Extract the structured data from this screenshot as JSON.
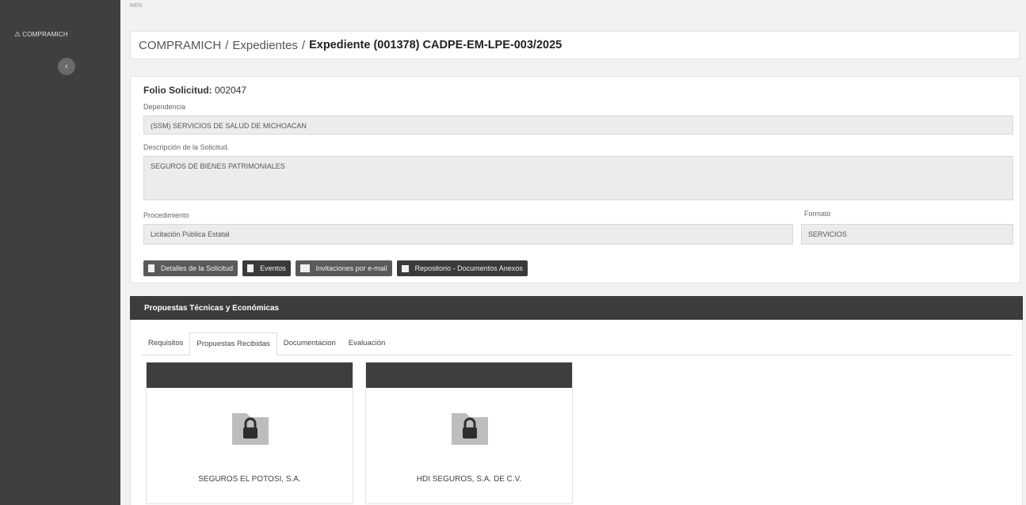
{
  "app": {
    "brand": "COMPRAMICH",
    "top_label": "MEN",
    "collapse_icon": "chevron-left-icon"
  },
  "breadcrumb": {
    "root": "COMPRAMICH",
    "section": "Expedientes",
    "current": "Expediente (001378) CADPE-EM-LPE-003/2025",
    "separator": "/"
  },
  "detail": {
    "folio_label": "Folio Solicitud:",
    "folio_value": "002047",
    "dependencia_label": "Dependencia",
    "dependencia_value": "(SSM) SERVICIOS DE SALUD DE MICHOACAN",
    "descripcion_label": "Descripción de la Solicitud.",
    "descripcion_value": "SEGUROS DE BIENES PATRIMONIALES",
    "procedimiento_label": "Procedimiento",
    "procedimiento_value": "Licitación Pública Estatal",
    "formato_label": "Formato",
    "formato_value": "SERVICIOS"
  },
  "buttons": {
    "detalles": "Detalles de la Solicitud",
    "eventos": "Eventos",
    "invitaciones": "Invitaciones por e-mail",
    "repositorio": "Repositorio - Documentos Anexos"
  },
  "proposals": {
    "title": "Propuestas Técnicas y Económicas",
    "tabs": [
      "Requisitos",
      "Propuestas Recibidas",
      "Documentacion",
      "Evaluación"
    ],
    "active_tab": "Propuestas Recibidas",
    "cards": [
      {
        "name": "SEGUROS EL POTOSI, S.A.",
        "icon": "locked-folder-icon"
      },
      {
        "name": "HDI SEGUROS, S.A. DE C.V.",
        "icon": "locked-folder-icon"
      }
    ]
  },
  "colors": {
    "sidebar": "#3f3f3f",
    "header_bar": "#3c3c3c",
    "button": "#5a5a5a"
  }
}
